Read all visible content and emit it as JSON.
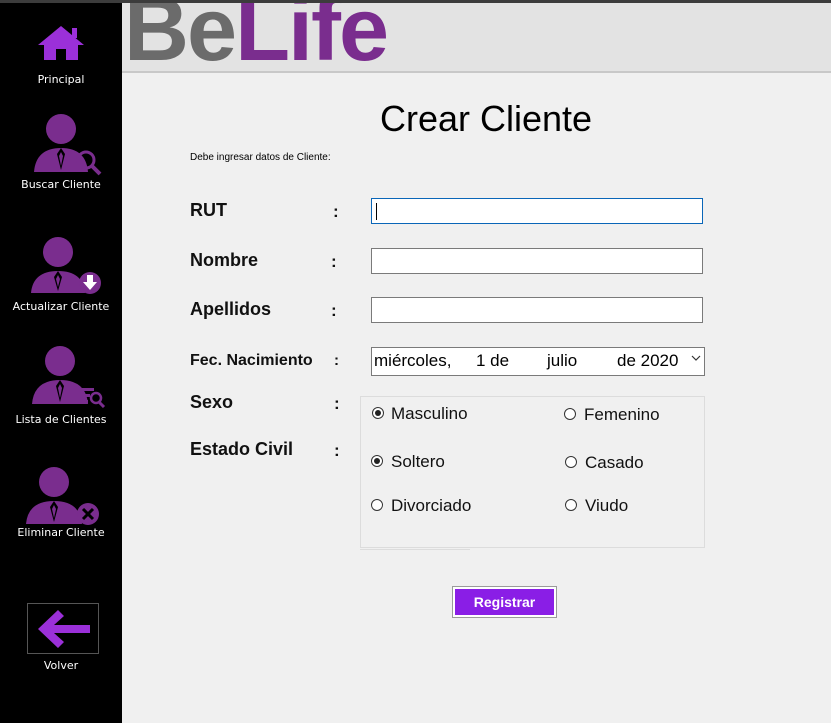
{
  "sidebar": {
    "items": [
      {
        "label": "Principal",
        "icon": "home-icon"
      },
      {
        "label": "Buscar Cliente",
        "icon": "user-search-icon"
      },
      {
        "label": "Actualizar Cliente",
        "icon": "user-update-icon"
      },
      {
        "label": "Lista de Clientes",
        "icon": "user-list-icon"
      },
      {
        "label": "Eliminar Cliente",
        "icon": "user-delete-icon"
      },
      {
        "label": "Volver",
        "icon": "back-arrow-icon"
      }
    ]
  },
  "header": {
    "logo_part1": "Be",
    "logo_part2": "Life"
  },
  "form": {
    "title": "Crear Cliente",
    "subtitle": "Debe ingresar datos de Cliente:",
    "labels": {
      "rut": "RUT",
      "nombre": "Nombre",
      "apellidos": "Apellidos",
      "fecha": "Fec. Nacimiento",
      "sexo": "Sexo",
      "estado_civil": "Estado Civil"
    },
    "colon": ":",
    "values": {
      "rut": "",
      "nombre": "",
      "apellidos": ""
    },
    "date": {
      "weekday": "miércoles,",
      "day": "1 de",
      "month": "julio",
      "year": "de 2020"
    },
    "sexo_options": [
      {
        "label": "Masculino",
        "selected": true
      },
      {
        "label": "Femenino",
        "selected": false
      }
    ],
    "estado_options": [
      {
        "label": "Soltero",
        "selected": true
      },
      {
        "label": "Casado",
        "selected": false
      },
      {
        "label": "Divorciado",
        "selected": false
      },
      {
        "label": "Viudo",
        "selected": false
      }
    ],
    "submit_label": "Registrar"
  },
  "colors": {
    "accent": "#8a1ee6",
    "icon_purple": "#7a2d8e",
    "sidebar_bg": "#000000"
  }
}
